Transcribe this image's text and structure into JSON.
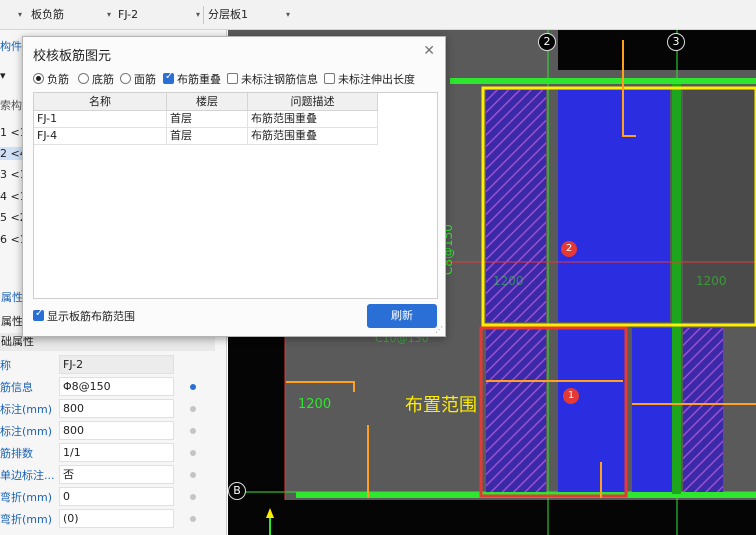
{
  "toolbar": {
    "combo1": "板负筋",
    "combo2": "FJ-2",
    "combo3": "分层板1"
  },
  "left_panel": {
    "tab1": "构件",
    "tab2": "索构",
    "rows": [
      "1 <1",
      "2 <4",
      "3 <1",
      "4 <1",
      "5 <2",
      "6 <1"
    ],
    "prop_section1": "属性",
    "prop_label": "属性名",
    "prop_section2": "础属性",
    "props": [
      {
        "key": "称",
        "value": "FJ-2"
      },
      {
        "key": "筋信息",
        "value": "Φ8@150"
      },
      {
        "key": "标注(mm)",
        "value": "800"
      },
      {
        "key": "标注(mm)",
        "value": "800"
      },
      {
        "key": "筋排数",
        "value": "1/1"
      },
      {
        "key": "单边标注...",
        "value": "否"
      },
      {
        "key": "弯折(mm)",
        "value": "0"
      },
      {
        "key": "弯折(mm)",
        "value": "(0)"
      }
    ]
  },
  "dialog": {
    "title": "校核板筋图元",
    "close_icon": "close-icon",
    "options": [
      {
        "label": "负筋",
        "type": "radio",
        "checked": true
      },
      {
        "label": "底筋",
        "type": "radio",
        "checked": false
      },
      {
        "label": "面筋",
        "type": "radio",
        "checked": false
      },
      {
        "label": "布筋重叠",
        "type": "checkbox",
        "checked": true
      },
      {
        "label": "未标注钢筋信息",
        "type": "checkbox",
        "checked": false
      },
      {
        "label": "未标注伸出长度",
        "type": "checkbox",
        "checked": false
      }
    ],
    "columns": [
      "名称",
      "楼层",
      "问题描述"
    ],
    "rows": [
      [
        "FJ-1",
        "首层",
        "布筋范围重叠"
      ],
      [
        "FJ-4",
        "首层",
        "布筋范围重叠"
      ]
    ],
    "show_range_label": "显示板筋布筋范围",
    "show_range_checked": true,
    "refresh_label": "刷新"
  },
  "canvas": {
    "axis_labels": [
      "2",
      "3",
      "B"
    ],
    "annotation": "布置范围",
    "badges": [
      "1",
      "2"
    ],
    "dim_texts": [
      "1200",
      "C8@150",
      "C10@150",
      "1200",
      "1200"
    ],
    "colors": {
      "background": "#050505",
      "slab": "#5a5a5a",
      "rebar_blue": "#2b2ee0",
      "hatch": "#7b3fb0",
      "highlight_yellow": "#ffee00",
      "highlight_red": "#e53935",
      "beam_green": "#2ee62e",
      "accent": "#2a6fd6"
    }
  }
}
